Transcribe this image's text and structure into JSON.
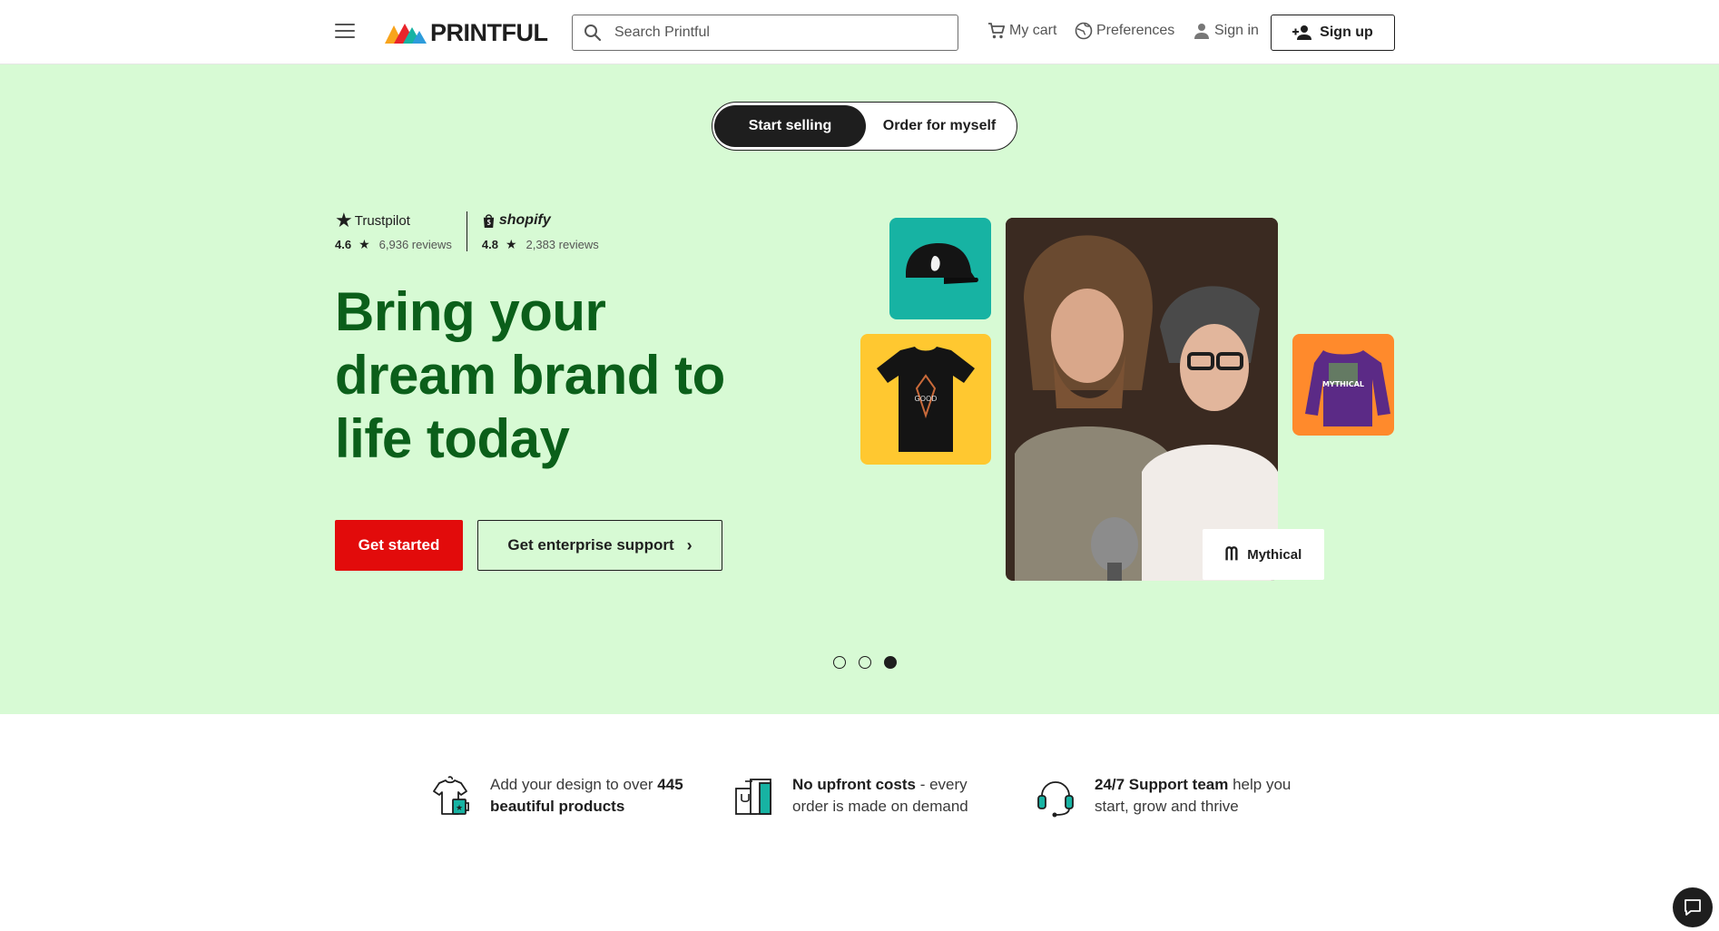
{
  "header": {
    "logo_text": "PRINTFUL",
    "search_placeholder": "Search Printful",
    "cart_label": "My cart",
    "preferences_label": "Preferences",
    "signin_label": "Sign in",
    "signup_label": "Sign up"
  },
  "hero": {
    "toggle": {
      "active_label": "Start selling",
      "inactive_label": "Order for myself"
    },
    "ratings": [
      {
        "brand": "Trustpilot",
        "score": "4.6",
        "reviews": "6,936 reviews"
      },
      {
        "brand": "shopify",
        "score": "4.8",
        "reviews": "2,383 reviews"
      }
    ],
    "headline": "Bring your dream brand to life today",
    "primary_cta": "Get started",
    "secondary_cta": "Get enterprise support",
    "badge_label": "Mythical",
    "slide_count": 3,
    "active_slide": 3
  },
  "features": [
    {
      "pre": "Add your design to over ",
      "bold": "445 beautiful products",
      "post": ""
    },
    {
      "pre": "",
      "bold": "No upfront costs",
      "post": " - every order is made on demand"
    },
    {
      "pre": "",
      "bold": "24/7 Support team",
      "post": " help you start, grow and thrive"
    }
  ],
  "colors": {
    "hero_bg": "#d7fad4",
    "headline": "#0b5f1a",
    "primary_cta": "#e20b0b",
    "teal_tile": "#17b3a3",
    "yellow_tile": "#ffc830",
    "orange_tile": "#ff8a2c"
  }
}
